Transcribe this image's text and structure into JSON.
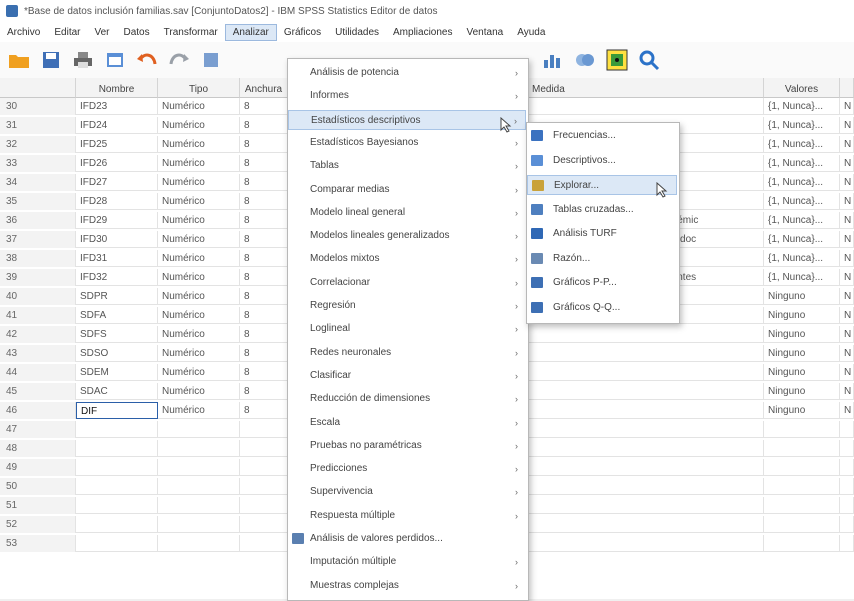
{
  "window": {
    "title": "*Base de datos inclusión familias.sav [ConjuntoDatos2] - IBM SPSS Statistics Editor de datos"
  },
  "menubar": [
    "Archivo",
    "Editar",
    "Ver",
    "Datos",
    "Transformar",
    "Analizar",
    "Gráficos",
    "Utilidades",
    "Ampliaciones",
    "Ventana",
    "Ayuda"
  ],
  "grid": {
    "headers": {
      "name": "Nombre",
      "type": "Tipo",
      "width": "Anchura",
      "measure": "Medida",
      "values": "Valores"
    },
    "rows": [
      {
        "num": "30",
        "name": "IFD23",
        "type": "Numérico",
        "width": "8",
        "meas": "",
        "val": "{1, Nunca}...",
        "last": "N"
      },
      {
        "num": "31",
        "name": "IFD24",
        "type": "Numérico",
        "width": "8",
        "meas": "",
        "val": "{1, Nunca}...",
        "last": "N"
      },
      {
        "num": "32",
        "name": "IFD25",
        "type": "Numérico",
        "width": "8",
        "meas": "",
        "val": "{1, Nunca}...",
        "last": "N"
      },
      {
        "num": "33",
        "name": "IFD26",
        "type": "Numérico",
        "width": "8",
        "meas": "",
        "val": "{1, Nunca}...",
        "last": "N"
      },
      {
        "num": "34",
        "name": "IFD27",
        "type": "Numérico",
        "width": "8",
        "meas": "as",
        "val": "{1, Nunca}...",
        "last": "N"
      },
      {
        "num": "35",
        "name": "IFD28",
        "type": "Numérico",
        "width": "8",
        "meas": "",
        "val": "{1, Nunca}...",
        "last": "N"
      },
      {
        "num": "36",
        "name": "IFD29",
        "type": "Numérico",
        "width": "8",
        "meas": "ies académic",
        "val": "{1, Nunca}...",
        "last": "N"
      },
      {
        "num": "37",
        "name": "IFD30",
        "type": "Numérico",
        "width": "8",
        "meas": "je de los doc",
        "val": "{1, Nunca}...",
        "last": "N"
      },
      {
        "num": "38",
        "name": "IFD31",
        "type": "Numérico",
        "width": "8",
        "meas": "",
        "val": "{1, Nunca}...",
        "last": "N"
      },
      {
        "num": "39",
        "name": "IFD32",
        "type": "Numérico",
        "width": "8",
        "meas": "s y docentes",
        "val": "{1, Nunca}...",
        "last": "N"
      },
      {
        "num": "40",
        "name": "SDPR",
        "type": "Numérico",
        "width": "8",
        "meas": "",
        "val": "Ninguno",
        "last": "N"
      },
      {
        "num": "41",
        "name": "SDFA",
        "type": "Numérico",
        "width": "8",
        "meas": "",
        "val": "Ninguno",
        "last": "N"
      },
      {
        "num": "42",
        "name": "SDFS",
        "type": "Numérico",
        "width": "8",
        "meas": "",
        "val": "Ninguno",
        "last": "N"
      },
      {
        "num": "43",
        "name": "SDSO",
        "type": "Numérico",
        "width": "8",
        "meas": "",
        "val": "Ninguno",
        "last": "N"
      },
      {
        "num": "44",
        "name": "SDEM",
        "type": "Numérico",
        "width": "8",
        "meas": "",
        "val": "Ninguno",
        "last": "N"
      },
      {
        "num": "45",
        "name": "SDAC",
        "type": "Numérico",
        "width": "8",
        "meas": "",
        "val": "Ninguno",
        "last": "N"
      },
      {
        "num": "46",
        "name": "DIF",
        "type": "Numérico",
        "width": "8",
        "meas": "",
        "val": "Ninguno",
        "last": "N"
      },
      {
        "num": "47",
        "name": "",
        "type": "",
        "width": "",
        "meas": "",
        "val": "",
        "last": ""
      },
      {
        "num": "48",
        "name": "",
        "type": "",
        "width": "",
        "meas": "",
        "val": "",
        "last": ""
      },
      {
        "num": "49",
        "name": "",
        "type": "",
        "width": "",
        "meas": "",
        "val": "",
        "last": ""
      },
      {
        "num": "50",
        "name": "",
        "type": "",
        "width": "",
        "meas": "",
        "val": "",
        "last": ""
      },
      {
        "num": "51",
        "name": "",
        "type": "",
        "width": "",
        "meas": "",
        "val": "",
        "last": ""
      },
      {
        "num": "52",
        "name": "",
        "type": "",
        "width": "",
        "meas": "",
        "val": "",
        "last": ""
      },
      {
        "num": "53",
        "name": "",
        "type": "",
        "width": "",
        "meas": "",
        "val": "",
        "last": ""
      }
    ]
  },
  "analizar_menu": [
    {
      "label": "Análisis de potencia",
      "arrow": true
    },
    {
      "label": "Informes",
      "arrow": true
    },
    {
      "label": "Estadísticos descriptivos",
      "arrow": true
    },
    {
      "label": "Estadísticos Bayesianos",
      "arrow": true
    },
    {
      "label": "Tablas",
      "arrow": true
    },
    {
      "label": "Comparar medias",
      "arrow": true
    },
    {
      "label": "Modelo lineal general",
      "arrow": true
    },
    {
      "label": "Modelos lineales generalizados",
      "arrow": true
    },
    {
      "label": "Modelos mixtos",
      "arrow": true
    },
    {
      "label": "Correlacionar",
      "arrow": true
    },
    {
      "label": "Regresión",
      "arrow": true
    },
    {
      "label": "Loglineal",
      "arrow": true
    },
    {
      "label": "Redes neuronales",
      "arrow": true
    },
    {
      "label": "Clasificar",
      "arrow": true
    },
    {
      "label": "Reducción de dimensiones",
      "arrow": true
    },
    {
      "label": "Escala",
      "arrow": true
    },
    {
      "label": "Pruebas no paramétricas",
      "arrow": true
    },
    {
      "label": "Predicciones",
      "arrow": true
    },
    {
      "label": "Supervivencia",
      "arrow": true
    },
    {
      "label": "Respuesta múltiple",
      "arrow": true
    },
    {
      "label": "Análisis de valores perdidos...",
      "arrow": false
    },
    {
      "label": "Imputación múltiple",
      "arrow": true
    },
    {
      "label": "Muestras complejas",
      "arrow": true
    }
  ],
  "descriptivos_submenu": [
    {
      "label": "Frecuencias...",
      "color": "#3b72c0"
    },
    {
      "label": "Descriptivos...",
      "color": "#5a8fd6"
    },
    {
      "label": "Explorar...",
      "color": "#c9a23a"
    },
    {
      "label": "Tablas cruzadas...",
      "color": "#4e7fbf"
    },
    {
      "label": "Análisis TURF",
      "color": "#2f68b5"
    },
    {
      "label": "Razón...",
      "color": "#6a8ab3"
    },
    {
      "label": "Gráficos P-P...",
      "color": "#3d6fb4"
    },
    {
      "label": "Gráficos Q-Q...",
      "color": "#3d6fb4"
    }
  ]
}
